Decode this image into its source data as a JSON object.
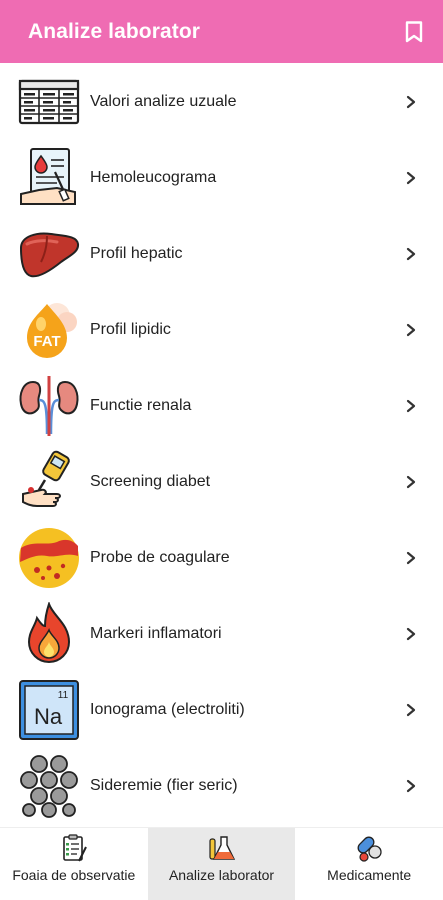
{
  "app_bar": {
    "title": "Analize laborator",
    "bookmark_icon": "bookmark-icon",
    "background": "#ef6cb3"
  },
  "list": {
    "items": [
      {
        "label": "Valori analize uzuale",
        "icon": "table-icon"
      },
      {
        "label": "Hemoleucograma",
        "icon": "blood-test-report-icon"
      },
      {
        "label": "Profil hepatic",
        "icon": "liver-icon"
      },
      {
        "label": "Profil lipidic",
        "icon": "fat-icon"
      },
      {
        "label": "Functie renala",
        "icon": "kidneys-icon"
      },
      {
        "label": "Screening diabet",
        "icon": "glucometer-icon"
      },
      {
        "label": "Probe de coagulare",
        "icon": "blood-clot-icon"
      },
      {
        "label": "Markeri inflamatori",
        "icon": "fire-icon"
      },
      {
        "label": "Ionograma (electroliti)",
        "icon": "sodium-element-icon"
      },
      {
        "label": "Sideremie (fier seric)",
        "icon": "iron-atoms-icon"
      }
    ]
  },
  "bottom_nav": {
    "items": [
      {
        "label": "Foaia de observatie",
        "icon": "clipboard-icon",
        "active": false
      },
      {
        "label": "Analize laborator",
        "icon": "lab-flask-icon",
        "active": true
      },
      {
        "label": "Medicamente",
        "icon": "pills-icon",
        "active": false
      }
    ]
  }
}
